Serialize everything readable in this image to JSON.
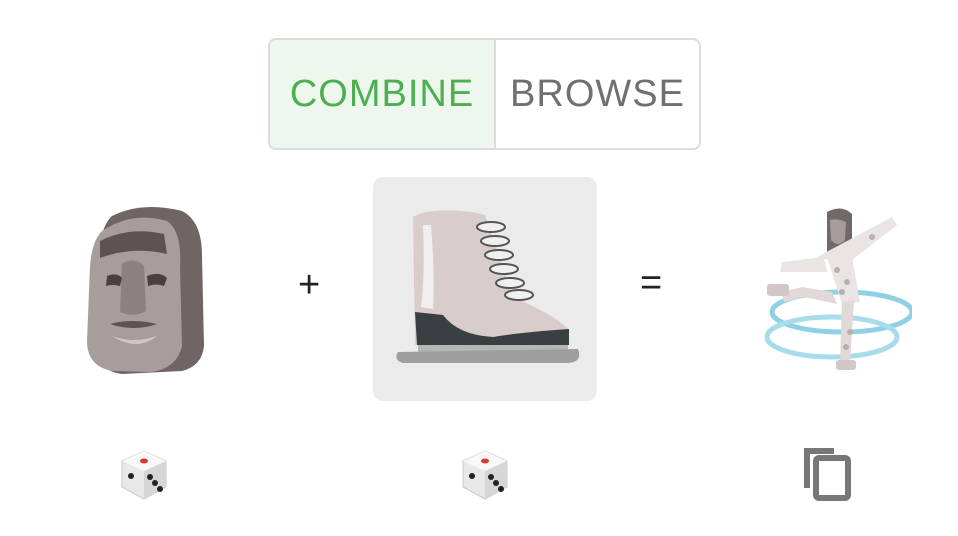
{
  "tabs": {
    "combine_label": "COMBINE",
    "browse_label": "BROWSE",
    "active": "combine"
  },
  "equation": {
    "left_emoji": "moai",
    "operator_plus": "+",
    "right_emoji": "ice-skate",
    "operator_equals": "=",
    "result_emoji": "moai-figure-skating"
  },
  "actions": {
    "left_random": "dice-icon",
    "right_random": "dice-icon",
    "copy_result": "copy-icon"
  },
  "colors": {
    "accent_green": "#4caf50",
    "active_tab_bg": "#edf7ed",
    "selected_slot_bg": "#ebebeb",
    "inactive_text": "#707070"
  }
}
